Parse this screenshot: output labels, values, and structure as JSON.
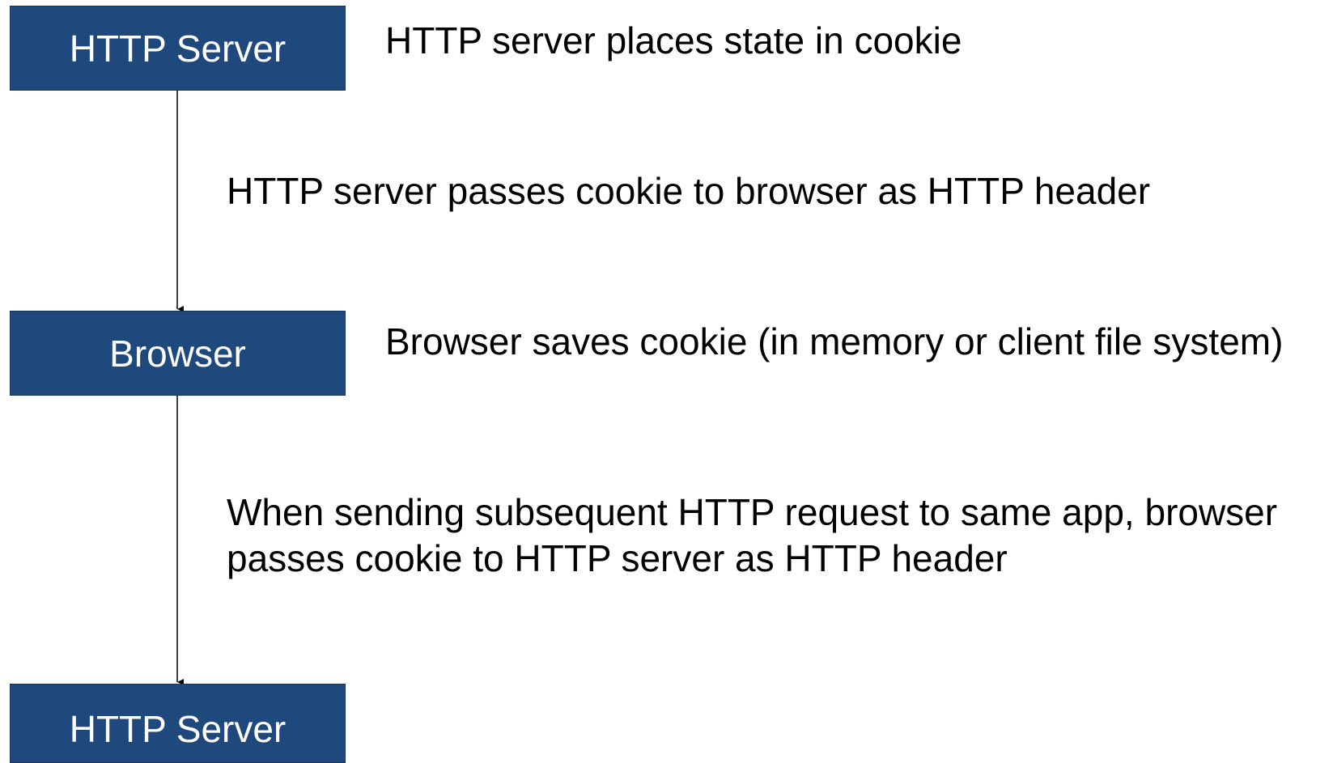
{
  "diagram": {
    "nodes": {
      "server_top": "HTTP Server",
      "browser": "Browser",
      "server_bottom": "HTTP Server"
    },
    "descriptions": {
      "step_1": "HTTP server places state in cookie",
      "step_2": "HTTP server passes cookie to browser as HTTP header",
      "step_3": "Browser saves cookie (in memory or client file system)",
      "step_4_line_1": "When sending subsequent HTTP request to same app, browser",
      "step_4_line_2": "passes cookie to HTTP server as HTTP header"
    },
    "colors": {
      "box_fill": "#1f497d",
      "box_text": "#ffffff",
      "connector": "#000000"
    }
  }
}
